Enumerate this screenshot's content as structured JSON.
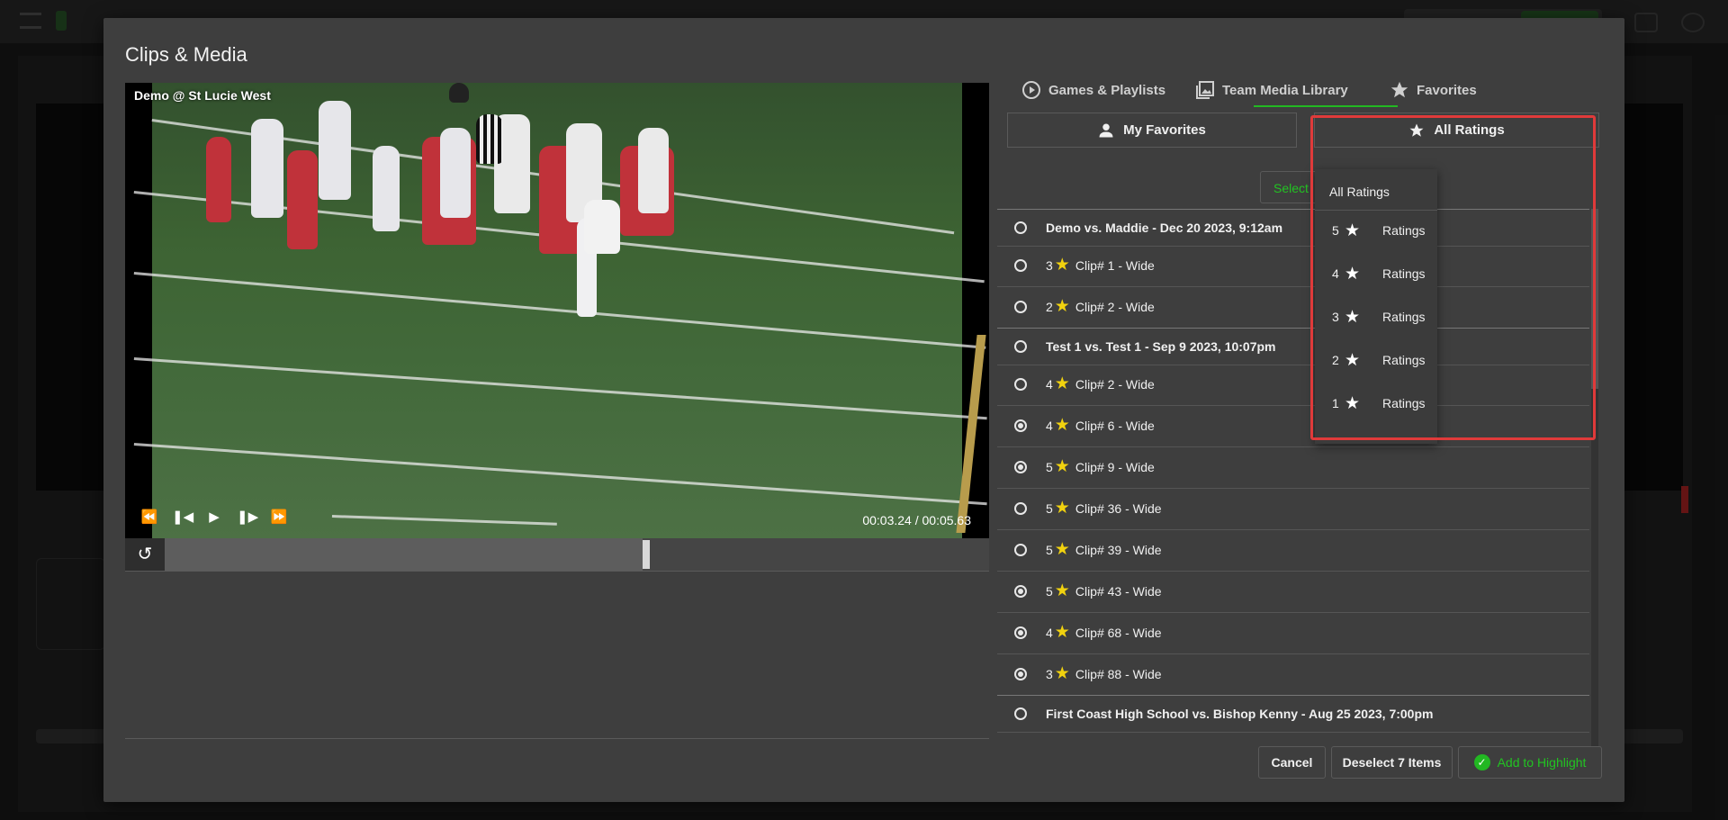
{
  "modal": {
    "title": "Clips & Media"
  },
  "video": {
    "label": "Demo @ St Lucie West",
    "timecode": "00:03.24 / 00:05.63",
    "progress_fraction": 0.58
  },
  "tabs": [
    {
      "label": "Games & Playlists",
      "icon": "play-circle-icon"
    },
    {
      "label": "Team Media Library",
      "icon": "photo-library-icon"
    },
    {
      "label": "Favorites",
      "icon": "star-icon",
      "active": true
    }
  ],
  "subtabs": {
    "my_favorites": "My Favorites",
    "all_ratings": "All Ratings"
  },
  "select_button": "Select",
  "dropdown": {
    "all": "All Ratings",
    "options": [
      {
        "rating": "5",
        "label": "Ratings"
      },
      {
        "rating": "4",
        "label": "Ratings"
      },
      {
        "rating": "3",
        "label": "Ratings"
      },
      {
        "rating": "2",
        "label": "Ratings"
      },
      {
        "rating": "1",
        "label": "Ratings"
      }
    ]
  },
  "list": {
    "rows": [
      {
        "type": "group",
        "title": "Demo vs. Maddie - Dec 20 2023, 9:12am",
        "selected": false
      },
      {
        "type": "clip",
        "rating": "3",
        "title": "Clip# 1 - Wide",
        "selected": false
      },
      {
        "type": "clip",
        "rating": "2",
        "title": "Clip# 2 - Wide",
        "selected": false
      },
      {
        "type": "group",
        "title": "Test 1 vs. Test 1 - Sep 9 2023, 10:07pm",
        "selected": false
      },
      {
        "type": "clip",
        "rating": "4",
        "title": "Clip# 2 - Wide",
        "selected": false
      },
      {
        "type": "clip",
        "rating": "4",
        "title": "Clip# 6 - Wide",
        "selected": true
      },
      {
        "type": "clip",
        "rating": "5",
        "title": "Clip# 9 - Wide",
        "selected": true
      },
      {
        "type": "clip",
        "rating": "5",
        "title": "Clip# 36 - Wide",
        "selected": false
      },
      {
        "type": "clip",
        "rating": "5",
        "title": "Clip# 39 - Wide",
        "selected": false
      },
      {
        "type": "clip",
        "rating": "5",
        "title": "Clip# 43 - Wide",
        "selected": true
      },
      {
        "type": "clip",
        "rating": "4",
        "title": "Clip# 68 - Wide",
        "selected": true
      },
      {
        "type": "clip",
        "rating": "3",
        "title": "Clip# 88 - Wide",
        "selected": true
      },
      {
        "type": "group",
        "title": "First Coast High School vs. Bishop Kenny - Aug 25 2023, 7:00pm",
        "selected": false
      }
    ]
  },
  "footer": {
    "cancel": "Cancel",
    "deselect": "Deselect 7 Items",
    "add": "Add to Highlight"
  },
  "colors": {
    "accent_green": "#22b822",
    "star_yellow": "#f1d20f",
    "highlight_red": "#e03a3a"
  }
}
